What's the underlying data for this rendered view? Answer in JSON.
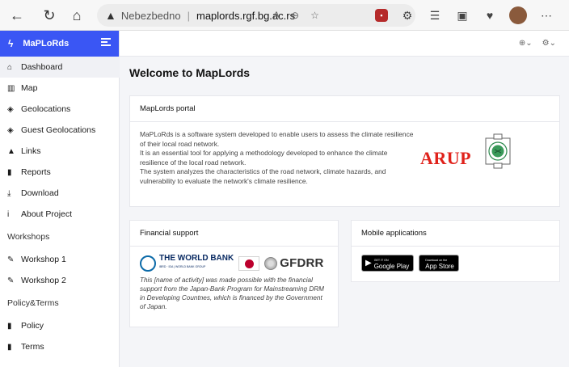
{
  "browser": {
    "security_label": "Nebezbedno",
    "url_domain": "maplords.rgf.bg.ac.rs"
  },
  "sidebar": {
    "brand": "MaPLoRds",
    "items": [
      {
        "label": "Dashboard",
        "icon": "home-icon"
      },
      {
        "label": "Map",
        "icon": "map-icon"
      },
      {
        "label": "Geolocations",
        "icon": "layers-icon"
      },
      {
        "label": "Guest Geolocations",
        "icon": "layers-icon"
      },
      {
        "label": "Links",
        "icon": "road-icon"
      },
      {
        "label": "Reports",
        "icon": "file-icon"
      },
      {
        "label": "Download",
        "icon": "download-icon"
      },
      {
        "label": "About Project",
        "icon": "info-icon"
      }
    ],
    "section_workshops": "Workshops",
    "workshops": [
      {
        "label": "Workshop 1",
        "icon": "edit-icon"
      },
      {
        "label": "Workshop 2",
        "icon": "edit-icon"
      }
    ],
    "section_policy": "Policy&Terms",
    "policy": [
      {
        "label": "Policy",
        "icon": "file-icon"
      },
      {
        "label": "Terms",
        "icon": "file-icon"
      }
    ]
  },
  "main": {
    "title": "Welcome to MapLords",
    "portal": {
      "header": "MapLords portal",
      "p1": "MaPLoRds is a software system developed to enable users to assess the climate resilience of their local road network.",
      "p2": "It is an essential tool for applying a methodology developed to enhance the climate resilience of the local road network.",
      "p3": "The system analyzes the characteristics of the road network, climate hazards, and vulnerability to evaluate the network's climate resilience.",
      "arup_logo": "ARUP"
    },
    "financial": {
      "header": "Financial support",
      "wb_name": "THE WORLD BANK",
      "wb_sub": "IBRD · IDA | WORLD BANK GROUP",
      "gfdrr": "GFDRR",
      "text": "This [name of activity] was made possible with the financial support from the Japan-Bank Program for Mainstreaming DRM in Developing Countnes, which is financed by the Government of Japan."
    },
    "mobile": {
      "header": "Mobile applications",
      "google_small": "GET IT ON",
      "google_big": "Google Play",
      "apple_small": "Download on the",
      "apple_big": "App Store"
    }
  }
}
